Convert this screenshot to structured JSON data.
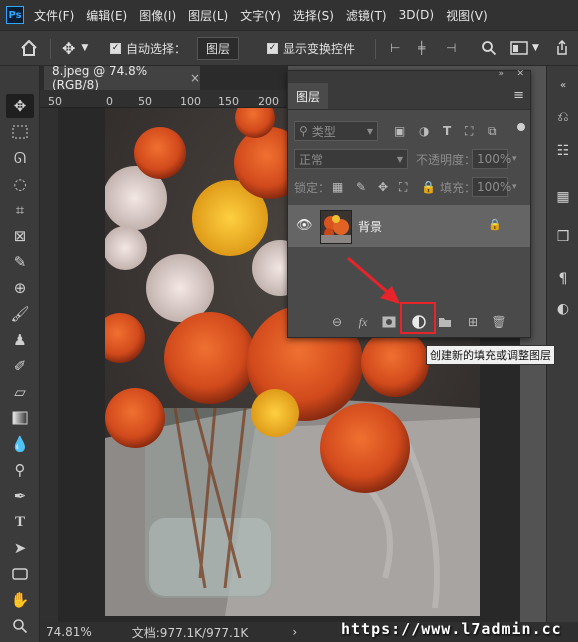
{
  "app": {
    "logo": "Ps"
  },
  "menu": [
    "文件(F)",
    "编辑(E)",
    "图像(I)",
    "图层(L)",
    "文字(Y)",
    "选择(S)",
    "滤镜(T)",
    "3D(D)",
    "视图(V)"
  ],
  "options": {
    "auto_select_label": "自动选择：",
    "auto_select_target": "图层",
    "show_transform_label": "显示变换控件"
  },
  "document": {
    "tab_title": "8.jpeg @ 74.8%(RGB/8)",
    "tab_close": "×",
    "ruler_ticks": [
      "50",
      "0",
      "50",
      "100",
      "150",
      "200"
    ]
  },
  "status": {
    "zoom": "74.81%",
    "doc_info": "文档:977.1K/977.1K",
    "arrow": "›"
  },
  "layers_panel": {
    "tab_title": "图层",
    "filter_placeholder": "类型",
    "blend_mode": "正常",
    "opacity_label": "不透明度：",
    "opacity_value": "100%",
    "lock_label": "锁定：",
    "fill_label": "填充：",
    "fill_value": "100%",
    "layers": [
      {
        "name": "背景",
        "visible": true,
        "locked": true
      }
    ],
    "bottom_buttons": [
      "link-layers",
      "fx",
      "add-mask",
      "new-fill-adjustment",
      "new-group",
      "new-layer",
      "delete-layer"
    ]
  },
  "tooltip": {
    "text": "创建新的填充或调整图层"
  },
  "watermark": {
    "text": "https://www.l7admin.cc"
  },
  "colors": {
    "highlight": "#e8242a",
    "arrow": "#e8242a",
    "panel_bg": "#4a4a4a",
    "app_bg": "#535353"
  }
}
